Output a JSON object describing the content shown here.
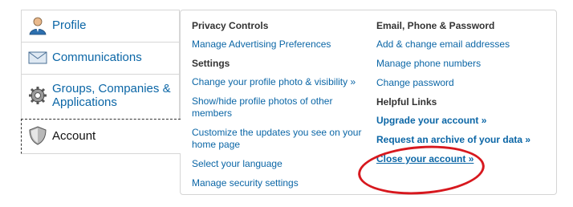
{
  "nav": {
    "items": [
      {
        "label": "Profile",
        "icon": "profile-icon"
      },
      {
        "label": "Communications",
        "icon": "envelope-icon"
      },
      {
        "label": "Groups, Companies & Applications",
        "icon": "gear-icon"
      },
      {
        "label": "Account",
        "icon": "shield-icon",
        "active": true
      }
    ]
  },
  "panel": {
    "left": {
      "privacy_heading": "Privacy Controls",
      "privacy_links": [
        "Manage Advertising Preferences"
      ],
      "settings_heading": "Settings",
      "settings_links": [
        "Change your profile photo & visibility »",
        "Show/hide profile photos of other members",
        "Customize the updates you see on your home page",
        "Select your language",
        "Manage security settings"
      ]
    },
    "right": {
      "email_heading": "Email, Phone & Password",
      "email_links": [
        "Add & change email addresses",
        "Manage phone numbers",
        "Change password"
      ],
      "helpful_heading": "Helpful Links",
      "helpful_links": [
        "Upgrade your account »",
        "Request an archive of your data »",
        "Close your account »"
      ]
    }
  },
  "colors": {
    "link": "#0b66a6",
    "highlight": "#d7181e"
  }
}
